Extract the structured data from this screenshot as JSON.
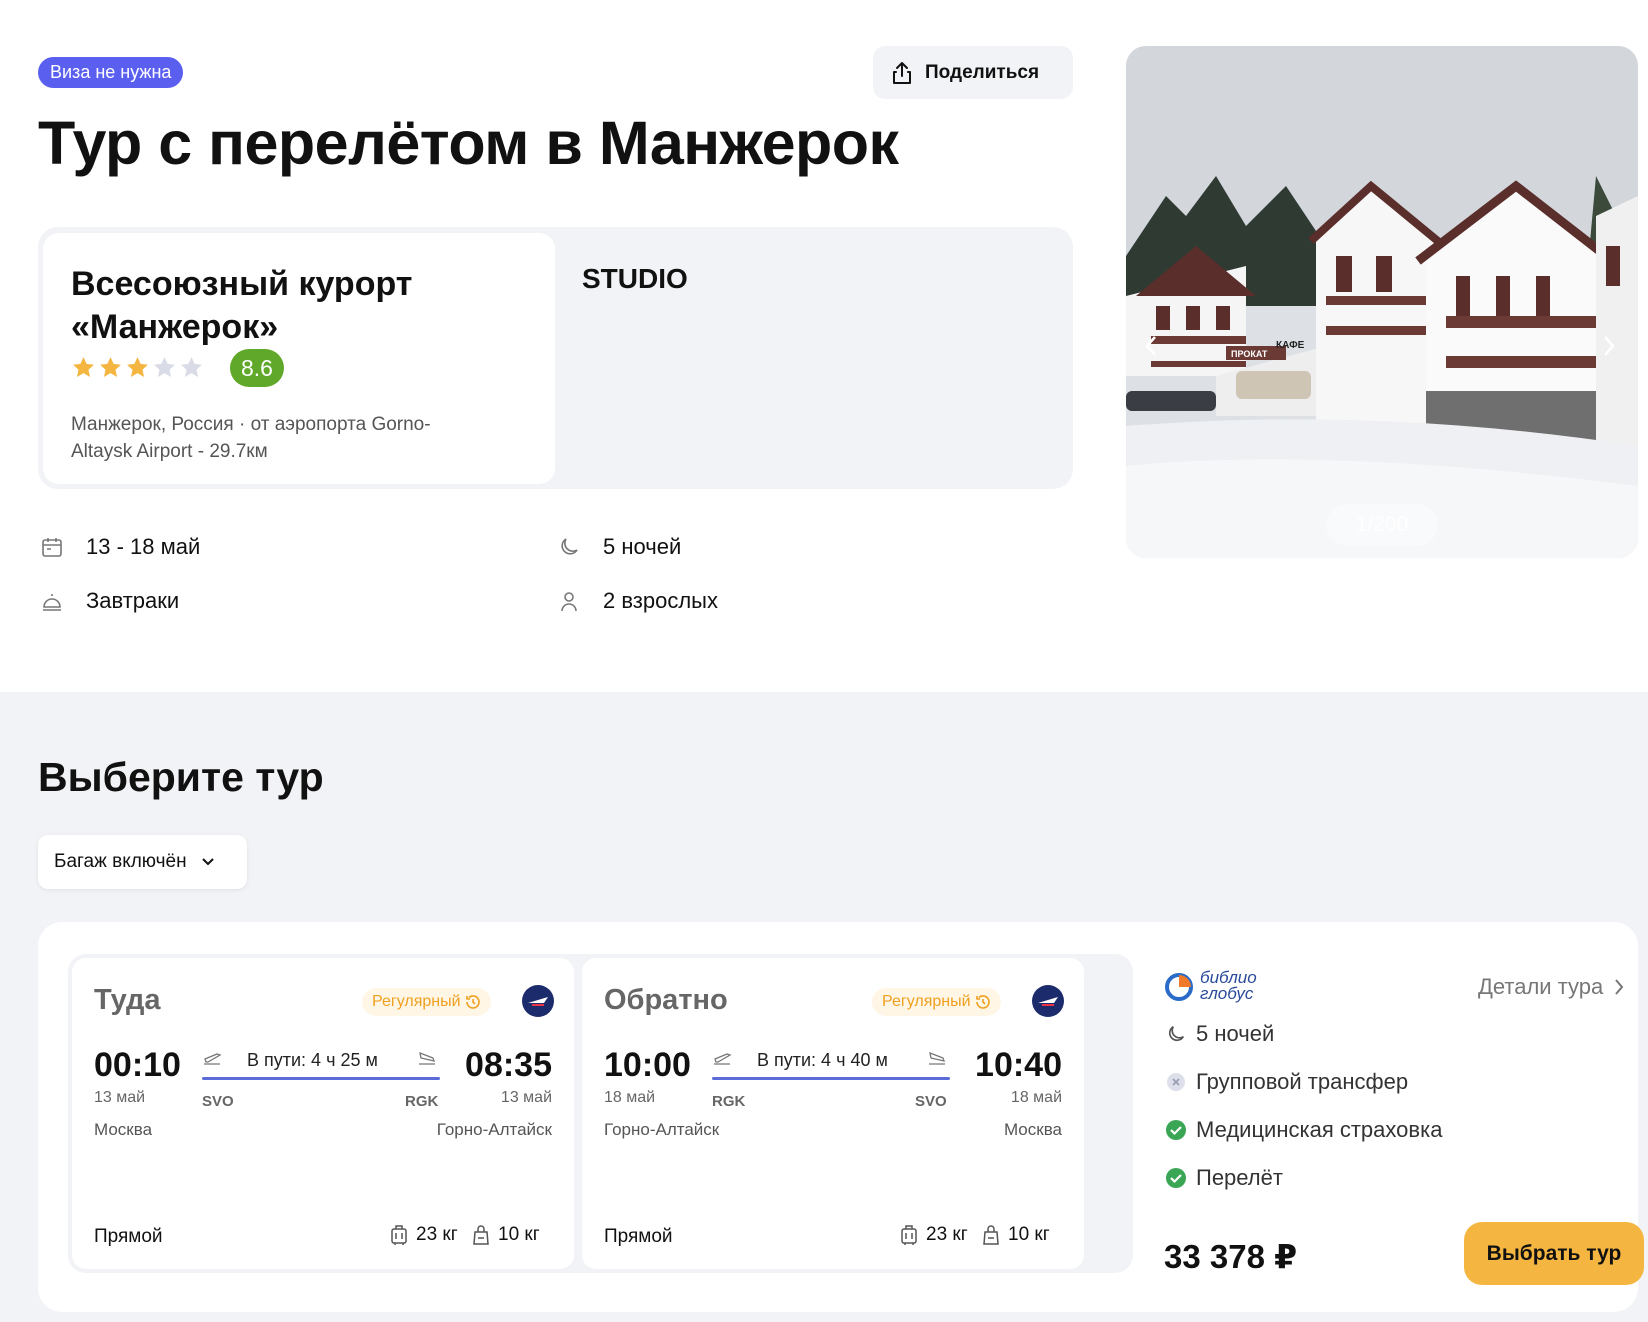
{
  "header": {
    "visa_badge": "Виза не нужна",
    "share_label": "Поделиться",
    "title": "Тур с перелётом в Манжерок"
  },
  "hotel": {
    "name": "Всесоюзный курорт «Манжерок»",
    "stars": 3,
    "stars_max": 5,
    "rating": "8.6",
    "location": "Манжерок, Россия · от аэропорта Gorno-Altaysk Airport - 29.7км",
    "room": "STUDIO"
  },
  "info": {
    "dates": "13 - 18 май",
    "nights": "5 ночей",
    "meals": "Завтраки",
    "guests": "2 взрослых"
  },
  "gallery": {
    "counter": "1/200",
    "sign_1": "ПРОКАТ",
    "sign_2": "КАФЕ"
  },
  "select": {
    "title": "Выберите тур",
    "baggage_filter": "Багаж включён"
  },
  "flights": [
    {
      "direction": "Туда",
      "type_badge": "Регулярный",
      "dep_time": "00:10",
      "dep_date": "13 май",
      "dep_city": "Москва",
      "dep_code": "SVO",
      "arr_time": "08:35",
      "arr_date": "13 май",
      "arr_city": "Горно-Алтайск",
      "arr_code": "RGK",
      "duration": "В пути: 4 ч 25 м",
      "stops": "Прямой",
      "baggage": "23 кг",
      "hand_luggage": "10 кг"
    },
    {
      "direction": "Обратно",
      "type_badge": "Регулярный",
      "dep_time": "10:00",
      "dep_date": "18 май",
      "dep_city": "Горно-Алтайск",
      "dep_code": "RGK",
      "arr_time": "10:40",
      "arr_date": "18 май",
      "arr_city": "Москва",
      "arr_code": "SVO",
      "duration": "В пути: 4 ч 40 м",
      "stops": "Прямой",
      "baggage": "23 кг",
      "hand_luggage": "10 кг"
    }
  ],
  "offer": {
    "operator_line1": "библио",
    "operator_line2": "глобус",
    "details_label": "Детали тура",
    "nights": "5 ночей",
    "features": [
      {
        "label": "Групповой трансфер",
        "included": false
      },
      {
        "label": "Медицинская страховка",
        "included": true
      },
      {
        "label": "Перелёт",
        "included": true
      }
    ],
    "price": "33 378 ₽",
    "choose_label": "Выбрать тур"
  },
  "colors": {
    "accent": "#5a5ff0",
    "rating": "#5fa829",
    "button": "#f5b641",
    "regular_badge": "#f0a020",
    "route_line": "#5b6cd9",
    "check": "#3aa655"
  }
}
